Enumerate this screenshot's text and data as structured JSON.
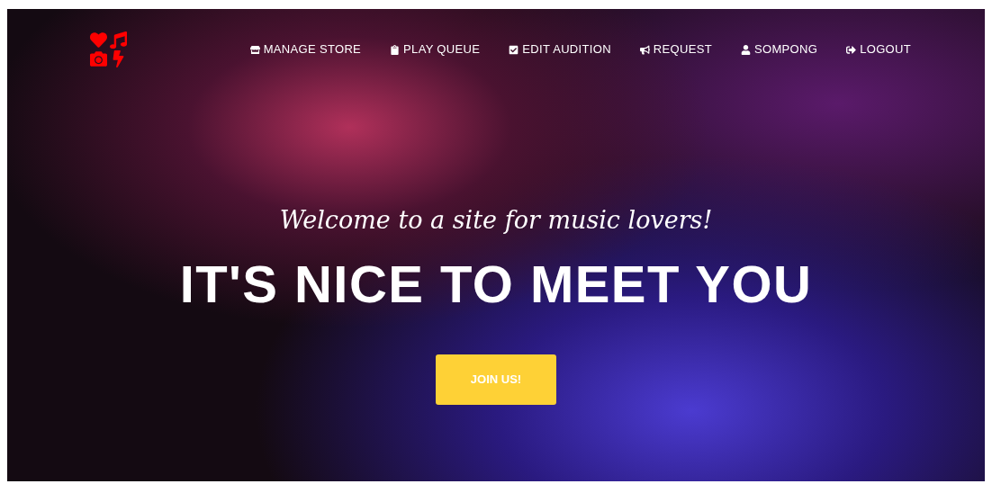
{
  "nav": {
    "items": [
      {
        "kind": "store",
        "label": "MANAGE STORE"
      },
      {
        "kind": "queue",
        "label": "PLAY QUEUE"
      },
      {
        "kind": "audition",
        "label": "EDIT AUDITION"
      },
      {
        "kind": "request",
        "label": "REQUEST"
      },
      {
        "kind": "user",
        "label": "SOMPONG"
      },
      {
        "kind": "logout",
        "label": "LOGOUT"
      }
    ]
  },
  "hero": {
    "subtitle": "Welcome to a site for music lovers!",
    "title": "IT'S NICE TO MEET YOU",
    "button": "JOIN US!"
  }
}
